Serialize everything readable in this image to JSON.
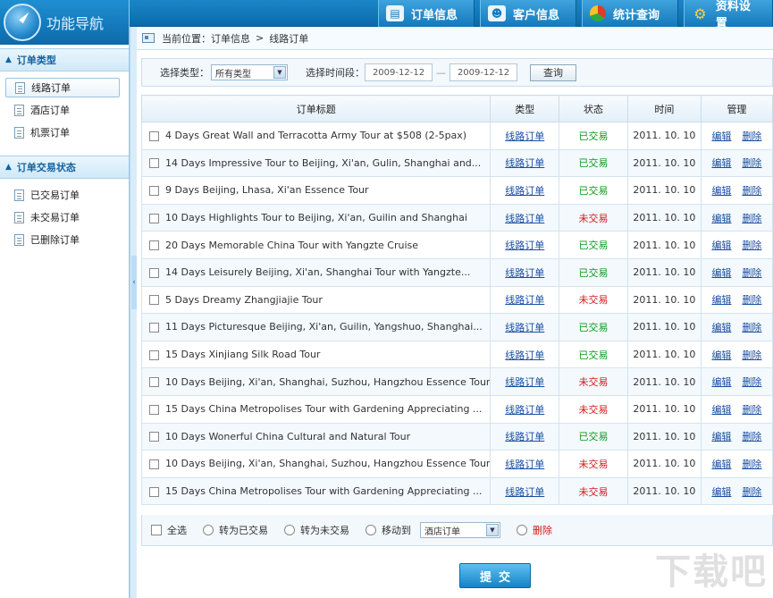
{
  "topnav": [
    {
      "label": "订单信息",
      "icon": "order-info-icon"
    },
    {
      "label": "客户信息",
      "icon": "customers-icon"
    },
    {
      "label": "统计查询",
      "icon": "pie-chart-icon"
    },
    {
      "label": "资料设置",
      "icon": "gear-icon"
    }
  ],
  "sidebar": {
    "title": "功能导航",
    "groups": [
      {
        "label": "订单类型",
        "items": [
          "线路订单",
          "酒店订单",
          "机票订单"
        ]
      },
      {
        "label": "订单交易状态",
        "items": [
          "已交易订单",
          "未交易订单",
          "已删除订单"
        ]
      }
    ],
    "collapse_glyph": "‹"
  },
  "breadcrumb": {
    "prefix": "当前位置：",
    "path": "订单信息",
    "sep": ">",
    "current": "线路订单"
  },
  "filter": {
    "type_label": "选择类型：",
    "type_value": "所有类型",
    "period_label": "选择时间段：",
    "date_from": "2009-12-12",
    "date_sep": "—",
    "date_to": "2009-12-12",
    "query_button": "查询"
  },
  "table": {
    "headers": [
      "订单标题",
      "类型",
      "状态",
      "时间",
      "管理"
    ],
    "edit_label": "编辑",
    "delete_label": "删除",
    "rows": [
      {
        "title": "4 Days Great Wall and Terracotta Army Tour at $508 (2-5pax)",
        "type": "线路订单",
        "status": "已交易",
        "date": "2011. 10. 10"
      },
      {
        "title": "14 Days Impressive Tour to Beijing, Xi'an, Gulin, Shanghai and...",
        "type": "线路订单",
        "status": "已交易",
        "date": "2011. 10. 10"
      },
      {
        "title": "9 Days Beijing, Lhasa, Xi'an Essence Tour",
        "type": "线路订单",
        "status": "已交易",
        "date": "2011. 10. 10"
      },
      {
        "title": "10 Days Highlights Tour to Beijing, Xi'an, Guilin and Shanghai",
        "type": "线路订单",
        "status": "未交易",
        "date": "2011. 10. 10"
      },
      {
        "title": "20 Days Memorable China Tour with Yangzte Cruise",
        "type": "线路订单",
        "status": "已交易",
        "date": "2011. 10. 10"
      },
      {
        "title": "14 Days Leisurely Beijing, Xi'an, Shanghai Tour with Yangzte...",
        "type": "线路订单",
        "status": "已交易",
        "date": "2011. 10. 10"
      },
      {
        "title": "5 Days Dreamy Zhangjiajie Tour",
        "type": "线路订单",
        "status": "未交易",
        "date": "2011. 10. 10"
      },
      {
        "title": "11 Days Picturesque Beijing, Xi'an, Guilin, Yangshuo, Shanghai...",
        "type": "线路订单",
        "status": "已交易",
        "date": "2011. 10. 10"
      },
      {
        "title": "15 Days Xinjiang Silk Road Tour",
        "type": "线路订单",
        "status": "已交易",
        "date": "2011. 10. 10"
      },
      {
        "title": "10 Days Beijing, Xi'an, Shanghai, Suzhou, Hangzhou Essence Tour",
        "type": "线路订单",
        "status": "未交易",
        "date": "2011. 10. 10"
      },
      {
        "title": "15 Days China Metropolises Tour with Gardening Appreciating ...",
        "type": "线路订单",
        "status": "未交易",
        "date": "2011. 10. 10"
      },
      {
        "title": "10 Days Wonerful China Cultural and Natural Tour",
        "type": "线路订单",
        "status": "已交易",
        "date": "2011. 10. 10"
      },
      {
        "title": "10 Days Beijing, Xi'an, Shanghai, Suzhou, Hangzhou Essence Tour",
        "type": "线路订单",
        "status": "未交易",
        "date": "2011. 10. 10"
      },
      {
        "title": "15 Days China Metropolises Tour with Gardening Appreciating ...",
        "type": "线路订单",
        "status": "未交易",
        "date": "2011. 10. 10"
      }
    ]
  },
  "bottom": {
    "select_all": "全选",
    "to_done": "转为已交易",
    "to_not": "转为未交易",
    "move_to": "移动到",
    "move_value": "酒店订单",
    "delete": "删除"
  },
  "submit_label": "提交",
  "watermark": "下载吧",
  "colors": {
    "accent": "#1479bb",
    "done": "#0a9a1c",
    "not_done": "#d21a1a",
    "link": "#1a4ea1"
  }
}
